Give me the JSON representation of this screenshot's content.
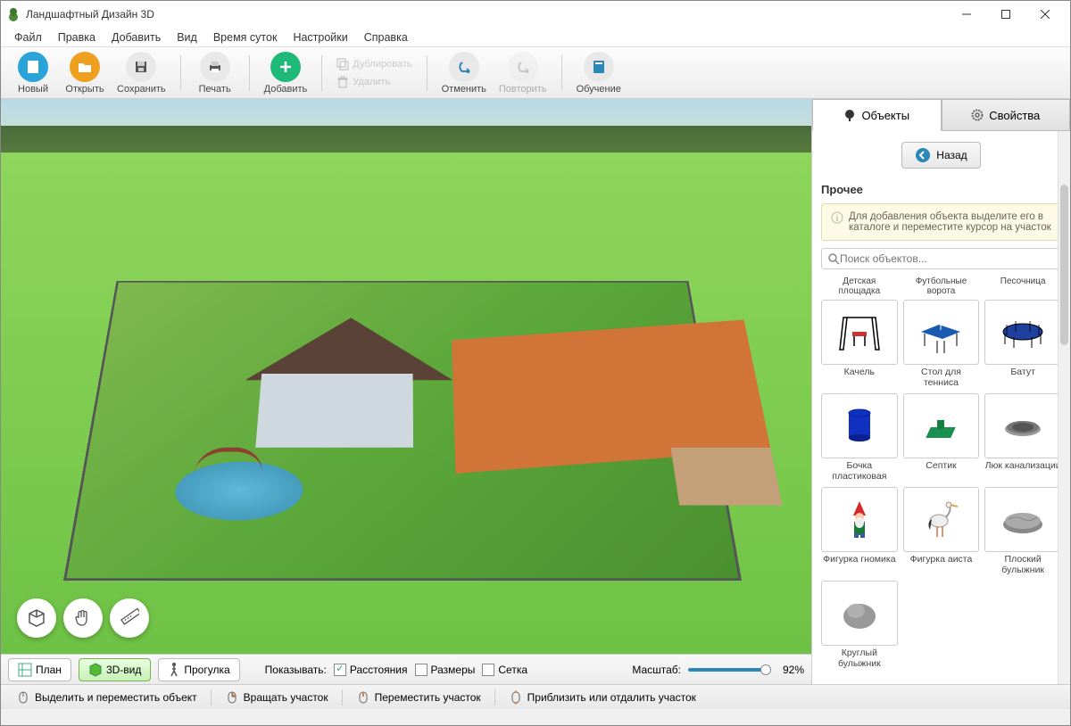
{
  "app": {
    "title": "Ландшафтный Дизайн 3D"
  },
  "menu": [
    "Файл",
    "Правка",
    "Добавить",
    "Вид",
    "Время суток",
    "Настройки",
    "Справка"
  ],
  "toolbar": {
    "new": "Новый",
    "open": "Открыть",
    "save": "Сохранить",
    "print": "Печать",
    "add": "Добавить",
    "duplicate": "Дублировать",
    "delete": "Удалить",
    "undo": "Отменить",
    "redo": "Повторить",
    "tutorial": "Обучение"
  },
  "viewbar": {
    "plan": "План",
    "view3d": "3D-вид",
    "walk": "Прогулка",
    "show_label": "Показывать:",
    "distances": "Расстояния",
    "sizes": "Размеры",
    "grid": "Сетка",
    "scale_label": "Масштаб:",
    "scale_value": "92%"
  },
  "sidepanel": {
    "tab_objects": "Объекты",
    "tab_properties": "Свойства",
    "back": "Назад",
    "category": "Прочее",
    "hint": "Для добавления объекта выделите его в каталоге и переместите курсор на участок",
    "search_placeholder": "Поиск объектов...",
    "header_labels": [
      "Детская площадка",
      "Футбольные ворота",
      "Песочница"
    ],
    "objects": [
      {
        "name": "Качель"
      },
      {
        "name": "Стол для тенниса"
      },
      {
        "name": "Батут"
      },
      {
        "name": "Бочка пластиковая"
      },
      {
        "name": "Септик"
      },
      {
        "name": "Люк канализации"
      },
      {
        "name": "Фигурка гномика"
      },
      {
        "name": "Фигурка аиста"
      },
      {
        "name": "Плоский булыжник"
      },
      {
        "name": "Круглый булыжник"
      }
    ]
  },
  "statusbar": {
    "select_move": "Выделить и переместить объект",
    "rotate": "Вращать участок",
    "move_plot": "Переместить участок",
    "zoom": "Приблизить или отдалить участок"
  }
}
